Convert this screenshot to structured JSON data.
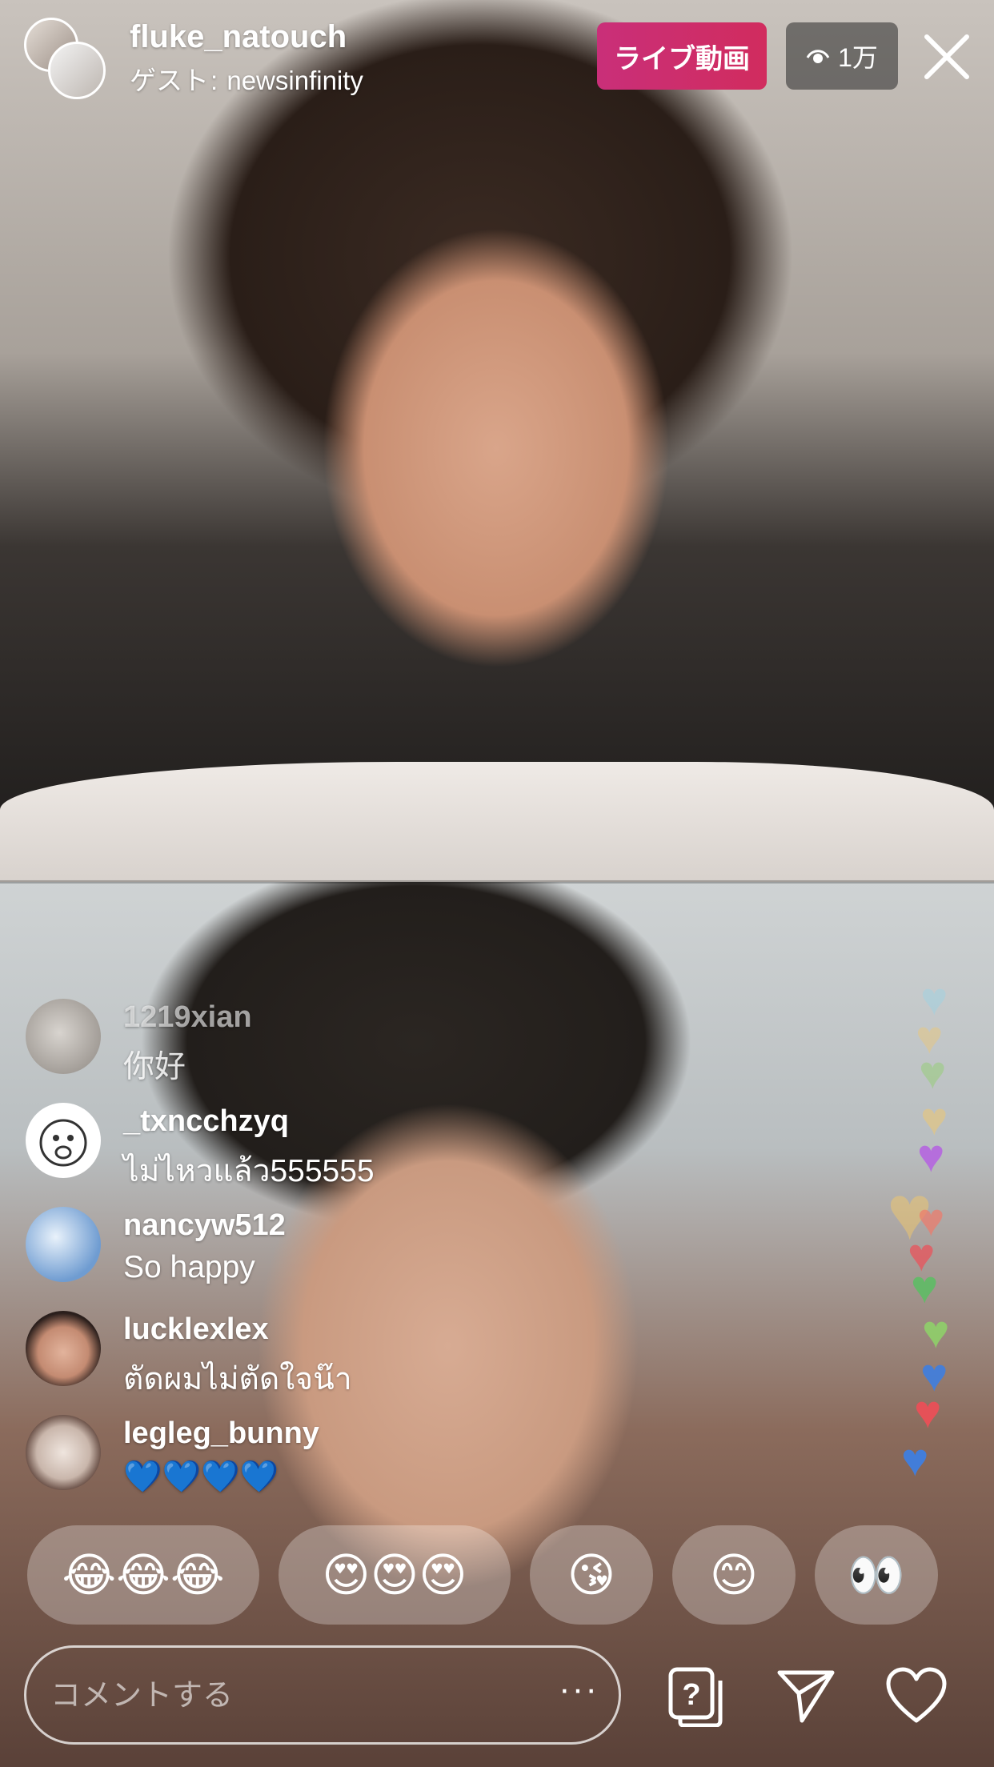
{
  "header": {
    "host_username": "fluke_natouch",
    "guest_prefix": "ゲスト",
    "guest_separator": ":",
    "guest_username": "newsinfinity",
    "live_badge": "ライブ動画",
    "viewer_count": "1万"
  },
  "comments": [
    {
      "username": "1219xian",
      "text": "你好",
      "faded": true
    },
    {
      "username": "_txncchzyq",
      "text": "ไม่ไหวแล้ว555555"
    },
    {
      "username": "nancyw512",
      "text": "So happy"
    },
    {
      "username": "lucklexlex",
      "text": "ตัดผมไม่ตัดใจน๊า"
    },
    {
      "username": "legleg_bunny",
      "text": "💙💙💙💙"
    }
  ],
  "quick_reactions": [
    "😂😂😂",
    "😍😍😍",
    "😘",
    "😊",
    "👀"
  ],
  "comment_input": {
    "placeholder": "コメントする",
    "more": "···"
  },
  "colors": {
    "live_badge": "#cf2e6c",
    "heart_colors": [
      "#9ad3e6",
      "#f3c86a",
      "#8fd06a",
      "#b566e0",
      "#f07a6a",
      "#5bbf63",
      "#3f7fe0",
      "#ef4e57"
    ]
  },
  "icons": [
    "close-icon",
    "eye-icon",
    "question-card-icon",
    "send-icon",
    "heart-icon"
  ]
}
